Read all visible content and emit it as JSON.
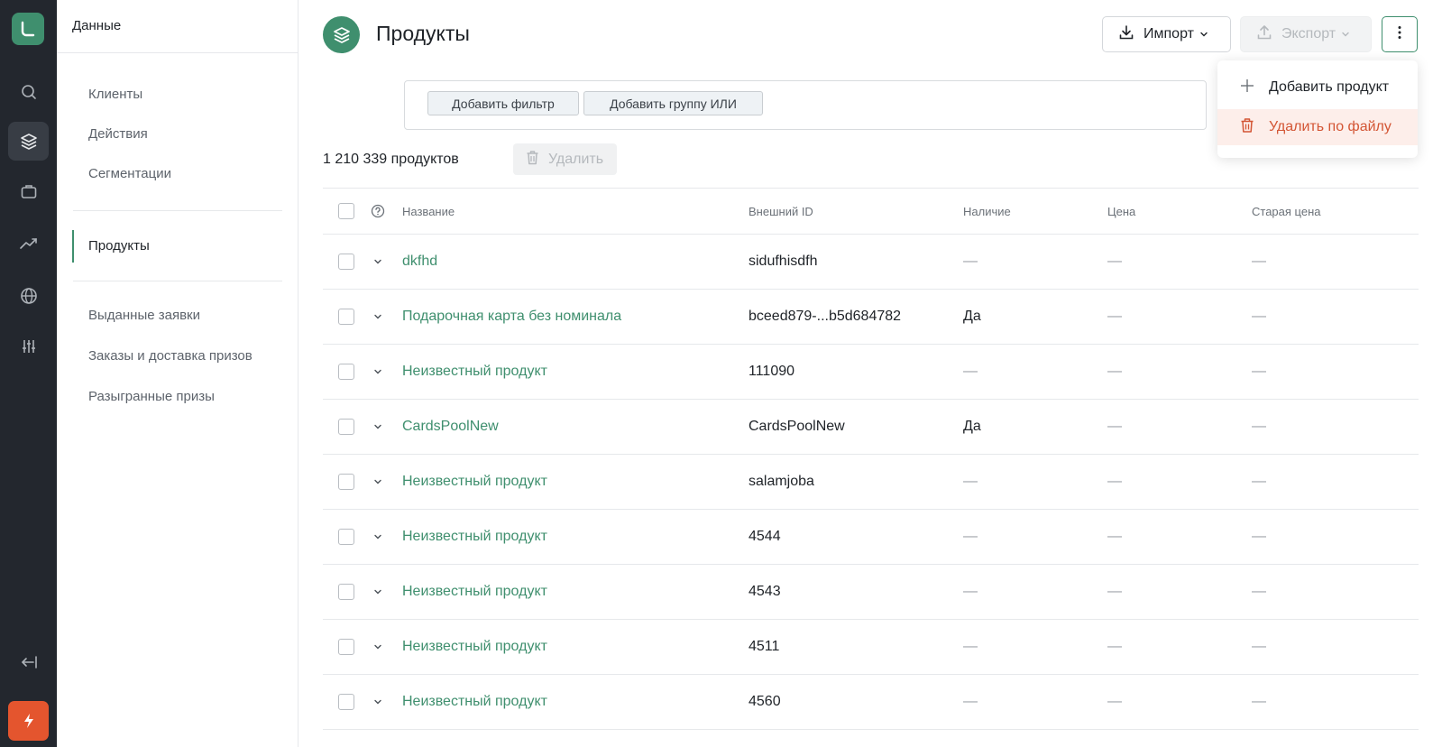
{
  "sidebar": {
    "section_title": "Данные",
    "items": [
      {
        "label": "Клиенты"
      },
      {
        "label": "Действия"
      },
      {
        "label": "Сегментации"
      },
      {
        "label": "Продукты"
      },
      {
        "label": "Выданные заявки"
      },
      {
        "label": "Заказы и доставка призов"
      },
      {
        "label": "Разыгранные призы"
      }
    ]
  },
  "header": {
    "title": "Продукты",
    "import_label": "Импорт",
    "export_label": "Экспорт"
  },
  "filters": {
    "add_filter": "Добавить фильтр",
    "add_or_group": "Добавить группу ИЛИ"
  },
  "toolbar": {
    "count_text": "1 210 339 продуктов",
    "delete_label": "Удалить"
  },
  "table": {
    "columns": [
      "Название",
      "Внешний ID",
      "Наличие",
      "Цена",
      "Старая цена"
    ],
    "rows": [
      {
        "name": "dkfhd",
        "external_id": "sidufhisdfh",
        "availability": "—",
        "price": "—",
        "old_price": "—"
      },
      {
        "name": "Подарочная карта без номинала",
        "external_id": "bceed879-...b5d684782",
        "availability": "Да",
        "price": "—",
        "old_price": "—"
      },
      {
        "name": "Неизвестный продукт",
        "external_id": "111090",
        "availability": "—",
        "price": "—",
        "old_price": "—"
      },
      {
        "name": "CardsPoolNew",
        "external_id": "CardsPoolNew",
        "availability": "Да",
        "price": "—",
        "old_price": "—"
      },
      {
        "name": "Неизвестный продукт",
        "external_id": "salamjoba",
        "availability": "—",
        "price": "—",
        "old_price": "—"
      },
      {
        "name": "Неизвестный продукт",
        "external_id": "4544",
        "availability": "—",
        "price": "—",
        "old_price": "—"
      },
      {
        "name": "Неизвестный продукт",
        "external_id": "4543",
        "availability": "—",
        "price": "—",
        "old_price": "—"
      },
      {
        "name": "Неизвестный продукт",
        "external_id": "4511",
        "availability": "—",
        "price": "—",
        "old_price": "—"
      },
      {
        "name": "Неизвестный продукт",
        "external_id": "4560",
        "availability": "—",
        "price": "—",
        "old_price": "—"
      }
    ]
  },
  "menu": {
    "add_product": "Добавить продукт",
    "delete_by_file": "Удалить по файлу"
  },
  "colors": {
    "accent": "#3f8f6e",
    "rail": "#23272e",
    "danger": "#d35534",
    "bolt": "#e4552e"
  }
}
